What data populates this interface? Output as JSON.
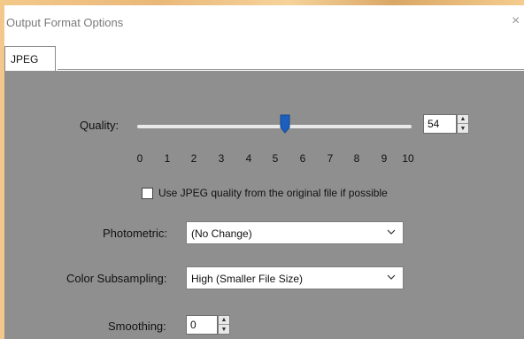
{
  "dialog": {
    "title": "Output Format Options",
    "close_glyph": "×"
  },
  "tabs": [
    {
      "label": "JPEG",
      "active": true
    }
  ],
  "quality": {
    "label": "Quality:",
    "value": "54",
    "slider_level": 5,
    "scale": [
      "0",
      "1",
      "2",
      "3",
      "4",
      "5",
      "6",
      "7",
      "8",
      "9",
      "10"
    ]
  },
  "use_original": {
    "label": "Use JPEG quality from the original file if possible",
    "checked": false
  },
  "photometric": {
    "label": "Photometric:",
    "selected": "(No Change)"
  },
  "color_subsampling": {
    "label": "Color Subsampling:",
    "selected": "High (Smaller File Size)"
  },
  "smoothing": {
    "label": "Smoothing:",
    "value": "0"
  },
  "icons": {
    "close": "close-icon",
    "spin_up": "arrow-up-icon",
    "spin_down": "arrow-down-icon",
    "chevron": "chevron-down-icon"
  },
  "colors": {
    "dialog_body": "#8f8f8f",
    "slider_thumb": "#1d5fbf",
    "backdrop": "#f2c98a"
  }
}
